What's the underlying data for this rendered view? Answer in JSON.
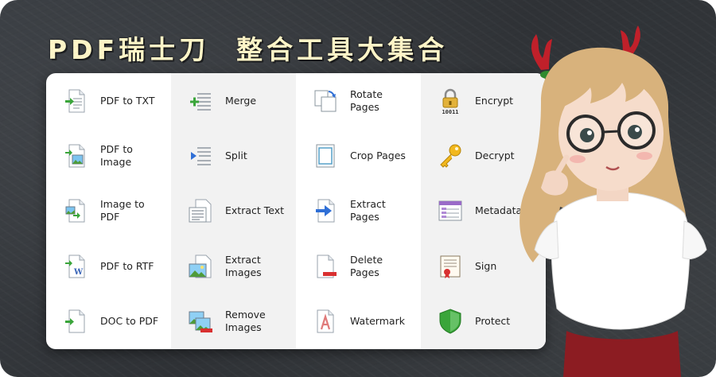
{
  "header": {
    "title_part1": "PDF瑞士刀",
    "title_part2": "整合工具大集合"
  },
  "columns": [
    {
      "items": [
        {
          "name": "pdf-to-txt",
          "label": "PDF to TXT",
          "icon": "pdf-to-txt-icon"
        },
        {
          "name": "pdf-to-image",
          "label": "PDF to Image",
          "icon": "pdf-to-image-icon"
        },
        {
          "name": "image-to-pdf",
          "label": "Image to PDF",
          "icon": "image-to-pdf-icon"
        },
        {
          "name": "pdf-to-rtf",
          "label": "PDF to RTF",
          "icon": "pdf-to-rtf-icon"
        },
        {
          "name": "doc-to-pdf",
          "label": "DOC to PDF",
          "icon": "doc-to-pdf-icon"
        }
      ]
    },
    {
      "items": [
        {
          "name": "merge",
          "label": "Merge",
          "icon": "merge-icon"
        },
        {
          "name": "split",
          "label": "Split",
          "icon": "split-icon"
        },
        {
          "name": "extract-text",
          "label": "Extract Text",
          "icon": "extract-text-icon"
        },
        {
          "name": "extract-images",
          "label": "Extract Images",
          "icon": "extract-images-icon"
        },
        {
          "name": "remove-images",
          "label": "Remove Images",
          "icon": "remove-images-icon"
        }
      ]
    },
    {
      "items": [
        {
          "name": "rotate-pages",
          "label": "Rotate Pages",
          "icon": "rotate-pages-icon"
        },
        {
          "name": "crop-pages",
          "label": "Crop Pages",
          "icon": "crop-pages-icon"
        },
        {
          "name": "extract-pages",
          "label": "Extract Pages",
          "icon": "extract-pages-icon"
        },
        {
          "name": "delete-pages",
          "label": "Delete Pages",
          "icon": "delete-pages-icon"
        },
        {
          "name": "watermark",
          "label": "Watermark",
          "icon": "watermark-icon"
        }
      ]
    },
    {
      "items": [
        {
          "name": "encrypt",
          "label": "Encrypt",
          "icon": "padlock-icon"
        },
        {
          "name": "decrypt",
          "label": "Decrypt",
          "icon": "key-icon"
        },
        {
          "name": "metadata",
          "label": "Metadata",
          "icon": "metadata-icon"
        },
        {
          "name": "sign",
          "label": "Sign",
          "icon": "certificate-icon"
        },
        {
          "name": "protect",
          "label": "Protect",
          "icon": "shield-icon"
        }
      ]
    }
  ],
  "icon_texts": {
    "encrypt_bits": "10011"
  },
  "colors": {
    "background": "#33373b",
    "title": "#fff6c8",
    "panel": "#ffffff",
    "panel_alt": "#f2f2f2",
    "accent_green": "#3aa53a",
    "accent_blue": "#2f6fd6",
    "accent_red": "#d93030"
  }
}
